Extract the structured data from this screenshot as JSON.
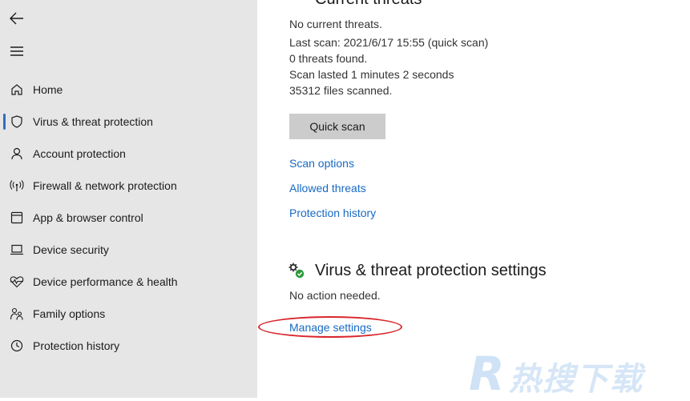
{
  "sidebar": {
    "back_icon": "back-arrow-icon",
    "menu_icon": "hamburger-menu-icon",
    "items": [
      {
        "label": "Home",
        "icon": "home-icon"
      },
      {
        "label": "Virus & threat protection",
        "icon": "shield-icon",
        "active": true
      },
      {
        "label": "Account protection",
        "icon": "person-icon"
      },
      {
        "label": "Firewall & network protection",
        "icon": "wireless-antenna-icon"
      },
      {
        "label": "App & browser control",
        "icon": "app-window-icon"
      },
      {
        "label": "Device security",
        "icon": "laptop-icon"
      },
      {
        "label": "Device performance & health",
        "icon": "heart-pulse-icon"
      },
      {
        "label": "Family options",
        "icon": "family-icon"
      },
      {
        "label": "Protection history",
        "icon": "history-icon"
      }
    ]
  },
  "current_threats": {
    "title": "Current threats",
    "no_threats": "No current threats.",
    "last_scan": "Last scan: 2021/6/17 15:55 (quick scan)",
    "threats_found": "0 threats found.",
    "scan_duration": "Scan lasted 1 minutes 2 seconds",
    "files_scanned": "35312 files scanned.",
    "quick_scan_button": "Quick scan",
    "links": {
      "scan_options": "Scan options",
      "allowed_threats": "Allowed threats",
      "protection_history": "Protection history"
    }
  },
  "vt_settings": {
    "title": "Virus & threat protection settings",
    "status": "No action needed.",
    "manage_link": "Manage settings"
  },
  "watermark": {
    "letter": "R",
    "text": "热搜下载"
  },
  "colors": {
    "sidebar_bg": "#e6e6e6",
    "link": "#1769c4",
    "button_bg": "#cccccc",
    "active_indicator": "#2f6fbf",
    "annotation": "#d8262b",
    "ok_green": "#2b9a3a"
  }
}
